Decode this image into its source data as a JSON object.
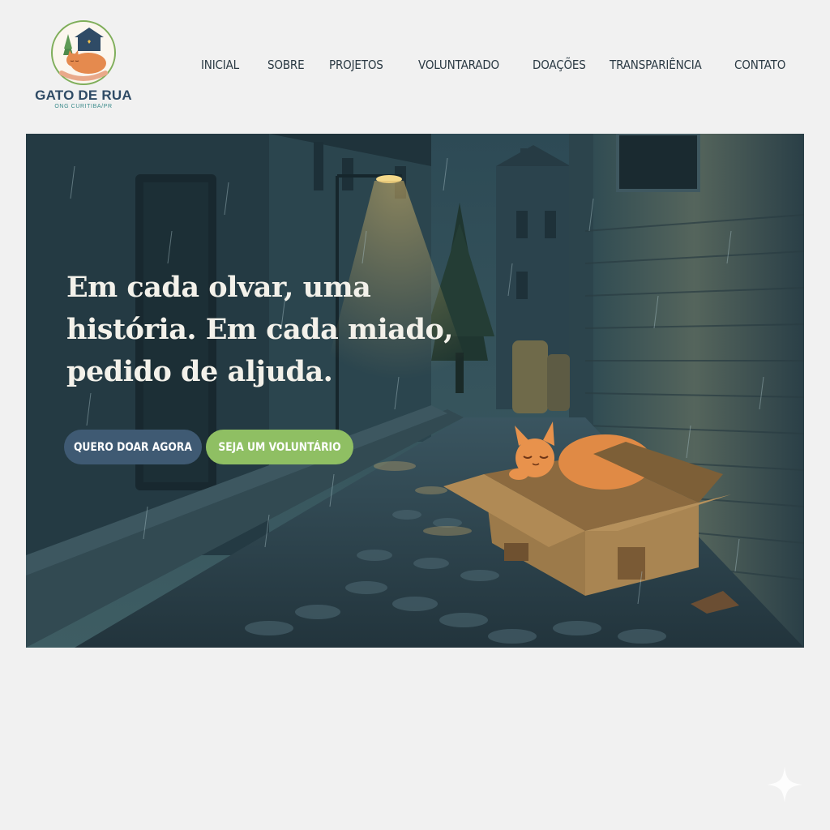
{
  "brand": {
    "name": "GATO DE RUA",
    "tagline": "ONG CURITIBA/PR",
    "logo_icon": "cat-house-logo"
  },
  "nav": {
    "items": [
      {
        "label": "INICIAL"
      },
      {
        "label": "SOBRE"
      },
      {
        "label": "PROJETOS"
      },
      {
        "label": "VOLUNTARADO"
      },
      {
        "label": "DOAÇÕES"
      },
      {
        "label": "TRANSPARIÊNCIA"
      },
      {
        "label": "CONTATO"
      }
    ]
  },
  "hero": {
    "headline_line1": "Em cada olvar, uma",
    "headline_line2": "história. Em cada miado,",
    "headline_line3": "pedido de aljuda.",
    "primary_button": "QUERO DOAR AGORA",
    "secondary_button": "SEJA UM VOLUNTÁRIO",
    "illustration": "rainy-alley-cat-in-box"
  },
  "colors": {
    "primary_button": "#3f5a73",
    "secondary_button": "#8fbf63",
    "nav_text": "#2b3a44",
    "brand_text": "#2f4b66",
    "page_bg": "#f1f1f1"
  },
  "decor": {
    "corner_icon": "sparkle-icon"
  }
}
